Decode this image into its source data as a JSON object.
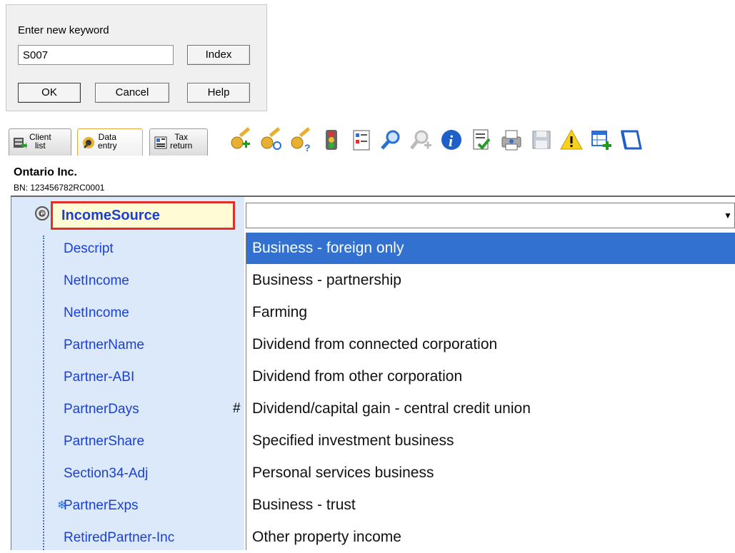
{
  "dialog": {
    "prompt": "Enter new keyword",
    "keyword_value": "S007",
    "index_label": "Index",
    "ok_label": "OK",
    "cancel_label": "Cancel",
    "help_label": "Help"
  },
  "tabs": [
    {
      "label": "Client\nlist",
      "icon": "client-list-icon"
    },
    {
      "label": "Data\nentry",
      "icon": "data-entry-icon"
    },
    {
      "label": "Tax\nreturn",
      "icon": "tax-return-icon"
    }
  ],
  "toolbar_icons": [
    "add-key-icon",
    "search-key-icon",
    "help-key-icon",
    "traffic-light-icon",
    "checklist-icon",
    "zoom-icon",
    "zoom-add-icon",
    "info-icon",
    "review-icon",
    "print-icon",
    "save-icon",
    "warning-icon",
    "add-table-icon",
    "form-icon"
  ],
  "client": {
    "name": "Ontario Inc.",
    "bn": "BN: 123456782RC0001"
  },
  "field": {
    "label": "IncomeSource",
    "value": ""
  },
  "tree_rows": [
    "Descript",
    "NetIncome",
    "NetIncome",
    "PartnerName",
    "Partner-ABI",
    "PartnerDays",
    "PartnerShare",
    "Section34-Adj",
    "PartnerExps",
    "RetiredPartner-Inc"
  ],
  "markers": {
    "hash": "#",
    "snowflake": "❄"
  },
  "dropdown_options": [
    "Business - foreign only",
    "Business - partnership",
    "Farming",
    "Dividend from connected corporation",
    "Dividend from other corporation",
    "Dividend/capital gain - central credit union",
    "Specified investment business",
    "Personal services business",
    "Business - trust",
    "Other property income"
  ],
  "selected_option": "Business - foreign only",
  "colors": {
    "selection": "#3271d0",
    "panel": "#dce9fb",
    "highlight_border": "#e13028",
    "label_blue": "#1a3fd6"
  }
}
